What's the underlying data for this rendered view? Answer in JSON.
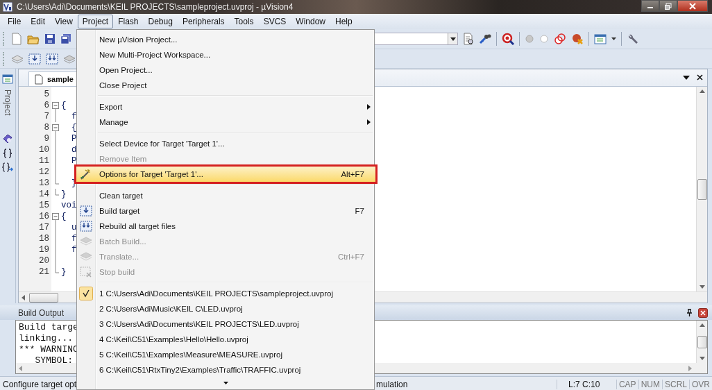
{
  "window": {
    "title": "C:\\Users\\Adi\\Documents\\KEIL PROJECTS\\sampleproject.uvproj - µVision4"
  },
  "menubar": [
    {
      "label": "File",
      "selected": false
    },
    {
      "label": "Edit",
      "selected": false
    },
    {
      "label": "View",
      "selected": false
    },
    {
      "label": "Project",
      "selected": true
    },
    {
      "label": "Flash",
      "selected": false
    },
    {
      "label": "Debug",
      "selected": false
    },
    {
      "label": "Peripherals",
      "selected": false
    },
    {
      "label": "Tools",
      "selected": false
    },
    {
      "label": "SVCS",
      "selected": false
    },
    {
      "label": "Window",
      "selected": false
    },
    {
      "label": "Help",
      "selected": false
    }
  ],
  "side_panel": {
    "tab": "Project"
  },
  "editor": {
    "tab": "sample",
    "lines": [
      {
        "number": "5",
        "kind": "plain"
      },
      {
        "number": "6",
        "kind": "foldstart",
        "code": "{"
      },
      {
        "number": "7",
        "kind": "foldbody",
        "code": "  f"
      },
      {
        "number": "8",
        "kind": "foldstart",
        "code": "  {"
      },
      {
        "number": "9",
        "kind": "foldbody",
        "code": "  P"
      },
      {
        "number": "10",
        "kind": "foldbody",
        "code": "  d"
      },
      {
        "number": "11",
        "kind": "foldbody",
        "code": "  P"
      },
      {
        "number": "12",
        "kind": "foldbody"
      },
      {
        "number": "13",
        "kind": "foldend",
        "code": "  }"
      },
      {
        "number": "14",
        "kind": "foldend",
        "code": "}"
      },
      {
        "number": "15",
        "kind": "plain",
        "code": "voi"
      },
      {
        "number": "16",
        "kind": "foldstart",
        "code": "{"
      },
      {
        "number": "17",
        "kind": "foldbody",
        "code": "  u"
      },
      {
        "number": "18",
        "kind": "foldbody",
        "code": "  f"
      },
      {
        "number": "19",
        "kind": "foldbody",
        "code": "  f"
      },
      {
        "number": "20",
        "kind": "foldbody"
      },
      {
        "number": "21",
        "kind": "foldend",
        "code": "}"
      }
    ]
  },
  "project_menu": {
    "groups": [
      [
        {
          "label": "New µVision Project...",
          "selected": false,
          "disabled": false,
          "submenu": false
        },
        {
          "label": "New Multi-Project Workspace...",
          "selected": false,
          "disabled": false,
          "submenu": false
        },
        {
          "label": "Open Project...",
          "selected": false,
          "disabled": false,
          "submenu": false
        },
        {
          "label": "Close Project",
          "selected": false,
          "disabled": false,
          "submenu": false
        }
      ],
      [
        {
          "label": "Export",
          "selected": false,
          "disabled": false,
          "submenu": true
        },
        {
          "label": "Manage",
          "selected": false,
          "disabled": false,
          "submenu": true
        }
      ],
      [
        {
          "label": "Select Device for Target 'Target 1'...",
          "selected": false,
          "disabled": false,
          "submenu": false
        },
        {
          "label": "Remove Item",
          "selected": false,
          "disabled": true,
          "submenu": false
        },
        {
          "label": "Options for Target 'Target 1'...",
          "shortcut": "Alt+F7",
          "selected": true,
          "disabled": false,
          "submenu": false
        }
      ],
      [
        {
          "label": "Clean target",
          "selected": false,
          "disabled": false,
          "submenu": false
        },
        {
          "label": "Build target",
          "shortcut": "F7",
          "selected": false,
          "disabled": false,
          "submenu": false
        },
        {
          "label": "Rebuild all target files",
          "selected": false,
          "disabled": false,
          "submenu": false
        },
        {
          "label": "Batch Build...",
          "selected": false,
          "disabled": true,
          "submenu": false
        },
        {
          "label": "Translate...",
          "shortcut": "Ctrl+F7",
          "selected": false,
          "disabled": true,
          "submenu": false
        },
        {
          "label": "Stop build",
          "selected": false,
          "disabled": true,
          "submenu": false
        }
      ],
      [
        {
          "label": "1 C:\\Users\\Adi\\Documents\\KEIL PROJECTS\\sampleproject.uvproj",
          "selected": false,
          "disabled": false,
          "submenu": false,
          "checked": true
        },
        {
          "label": "2 C:\\Users\\Adi\\Music\\KEIL C\\LED.uvproj",
          "selected": false,
          "disabled": false,
          "submenu": false,
          "checked": false
        },
        {
          "label": "3 C:\\Users\\Adi\\Documents\\KEIL PROJECTS\\LED.uvproj",
          "selected": false,
          "disabled": false,
          "submenu": false,
          "checked": false
        },
        {
          "label": "4 C:\\Keil\\C51\\Examples\\Hello\\Hello.uvproj",
          "selected": false,
          "disabled": false,
          "submenu": false,
          "checked": false
        },
        {
          "label": "5 C:\\Keil\\C51\\Examples\\Measure\\MEASURE.uvproj",
          "selected": false,
          "disabled": false,
          "submenu": false,
          "checked": false
        },
        {
          "label": "6 C:\\Keil\\C51\\RtxTiny2\\Examples\\Traffic\\TRAFFIC.uvproj",
          "selected": false,
          "disabled": false,
          "submenu": false,
          "checked": false
        }
      ]
    ]
  },
  "build_output": {
    "title": "Build Output",
    "lines": [
      "Build targe",
      "linking...",
      "*** WARNINC",
      "   SYMBOL:"
    ]
  },
  "status_bar": {
    "hint": "Configure target opt",
    "mode": "mulation",
    "position": "L:7 C:10",
    "keys": [
      "CAP",
      "NUM",
      "SCRL",
      "OVR"
    ]
  }
}
